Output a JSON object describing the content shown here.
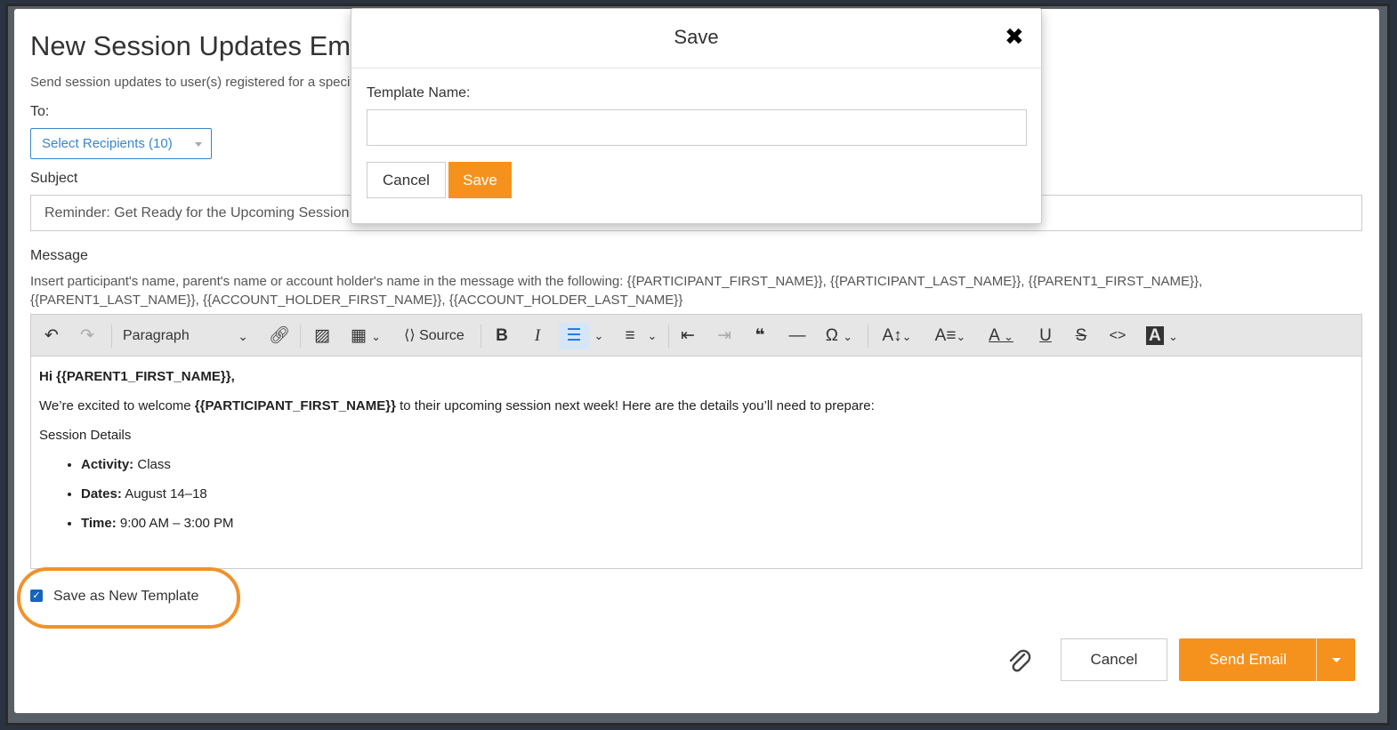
{
  "dialog": {
    "title": "New Session Updates Email",
    "subtitle": "Send session updates to user(s) registered for a specific session",
    "to_label": "To:",
    "recipients": "Select Recipients (10)",
    "subject_label": "Subject",
    "subject_value": "Reminder: Get Ready for the Upcoming Session",
    "message_label": "Message",
    "hint_line1": "Insert participant's name, parent's name or account holder's name in the message with the following: {{PARTICIPANT_FIRST_NAME}}, {{PARTICIPANT_LAST_NAME}}, {{PARENT1_FIRST_NAME}},",
    "hint_line2": "{{PARENT1_LAST_NAME}}, {{ACCOUNT_HOLDER_FIRST_NAME}}, {{ACCOUNT_HOLDER_LAST_NAME}}"
  },
  "toolbar": {
    "paragraph": "Paragraph",
    "source": "Source"
  },
  "editor": {
    "greeting": "Hi {{PARENT1_FIRST_NAME}},",
    "intro_before": "We’re excited to welcome ",
    "intro_token": "{{PARTICIPANT_FIRST_NAME}}",
    "intro_after": " to their upcoming session  next week! Here are the details you’ll need to prepare:",
    "details_heading": "Session Details",
    "items": [
      {
        "key": "Activity:",
        "value": " Class"
      },
      {
        "key": "Dates:",
        "value": " August 14–18"
      },
      {
        "key": "Time:",
        "value": " 9:00 AM – 3:00 PM"
      }
    ]
  },
  "save_template": {
    "label": "Save as New Template",
    "checked": true
  },
  "footer": {
    "cancel": "Cancel",
    "send": "Send Email"
  },
  "modal": {
    "title": "Save",
    "close_glyph": "✖",
    "field_label": "Template Name:",
    "field_value": "",
    "cancel": "Cancel",
    "save": "Save"
  },
  "colors": {
    "accent": "#f5921e",
    "link": "#3a86c8",
    "checkbox": "#1565c0"
  }
}
